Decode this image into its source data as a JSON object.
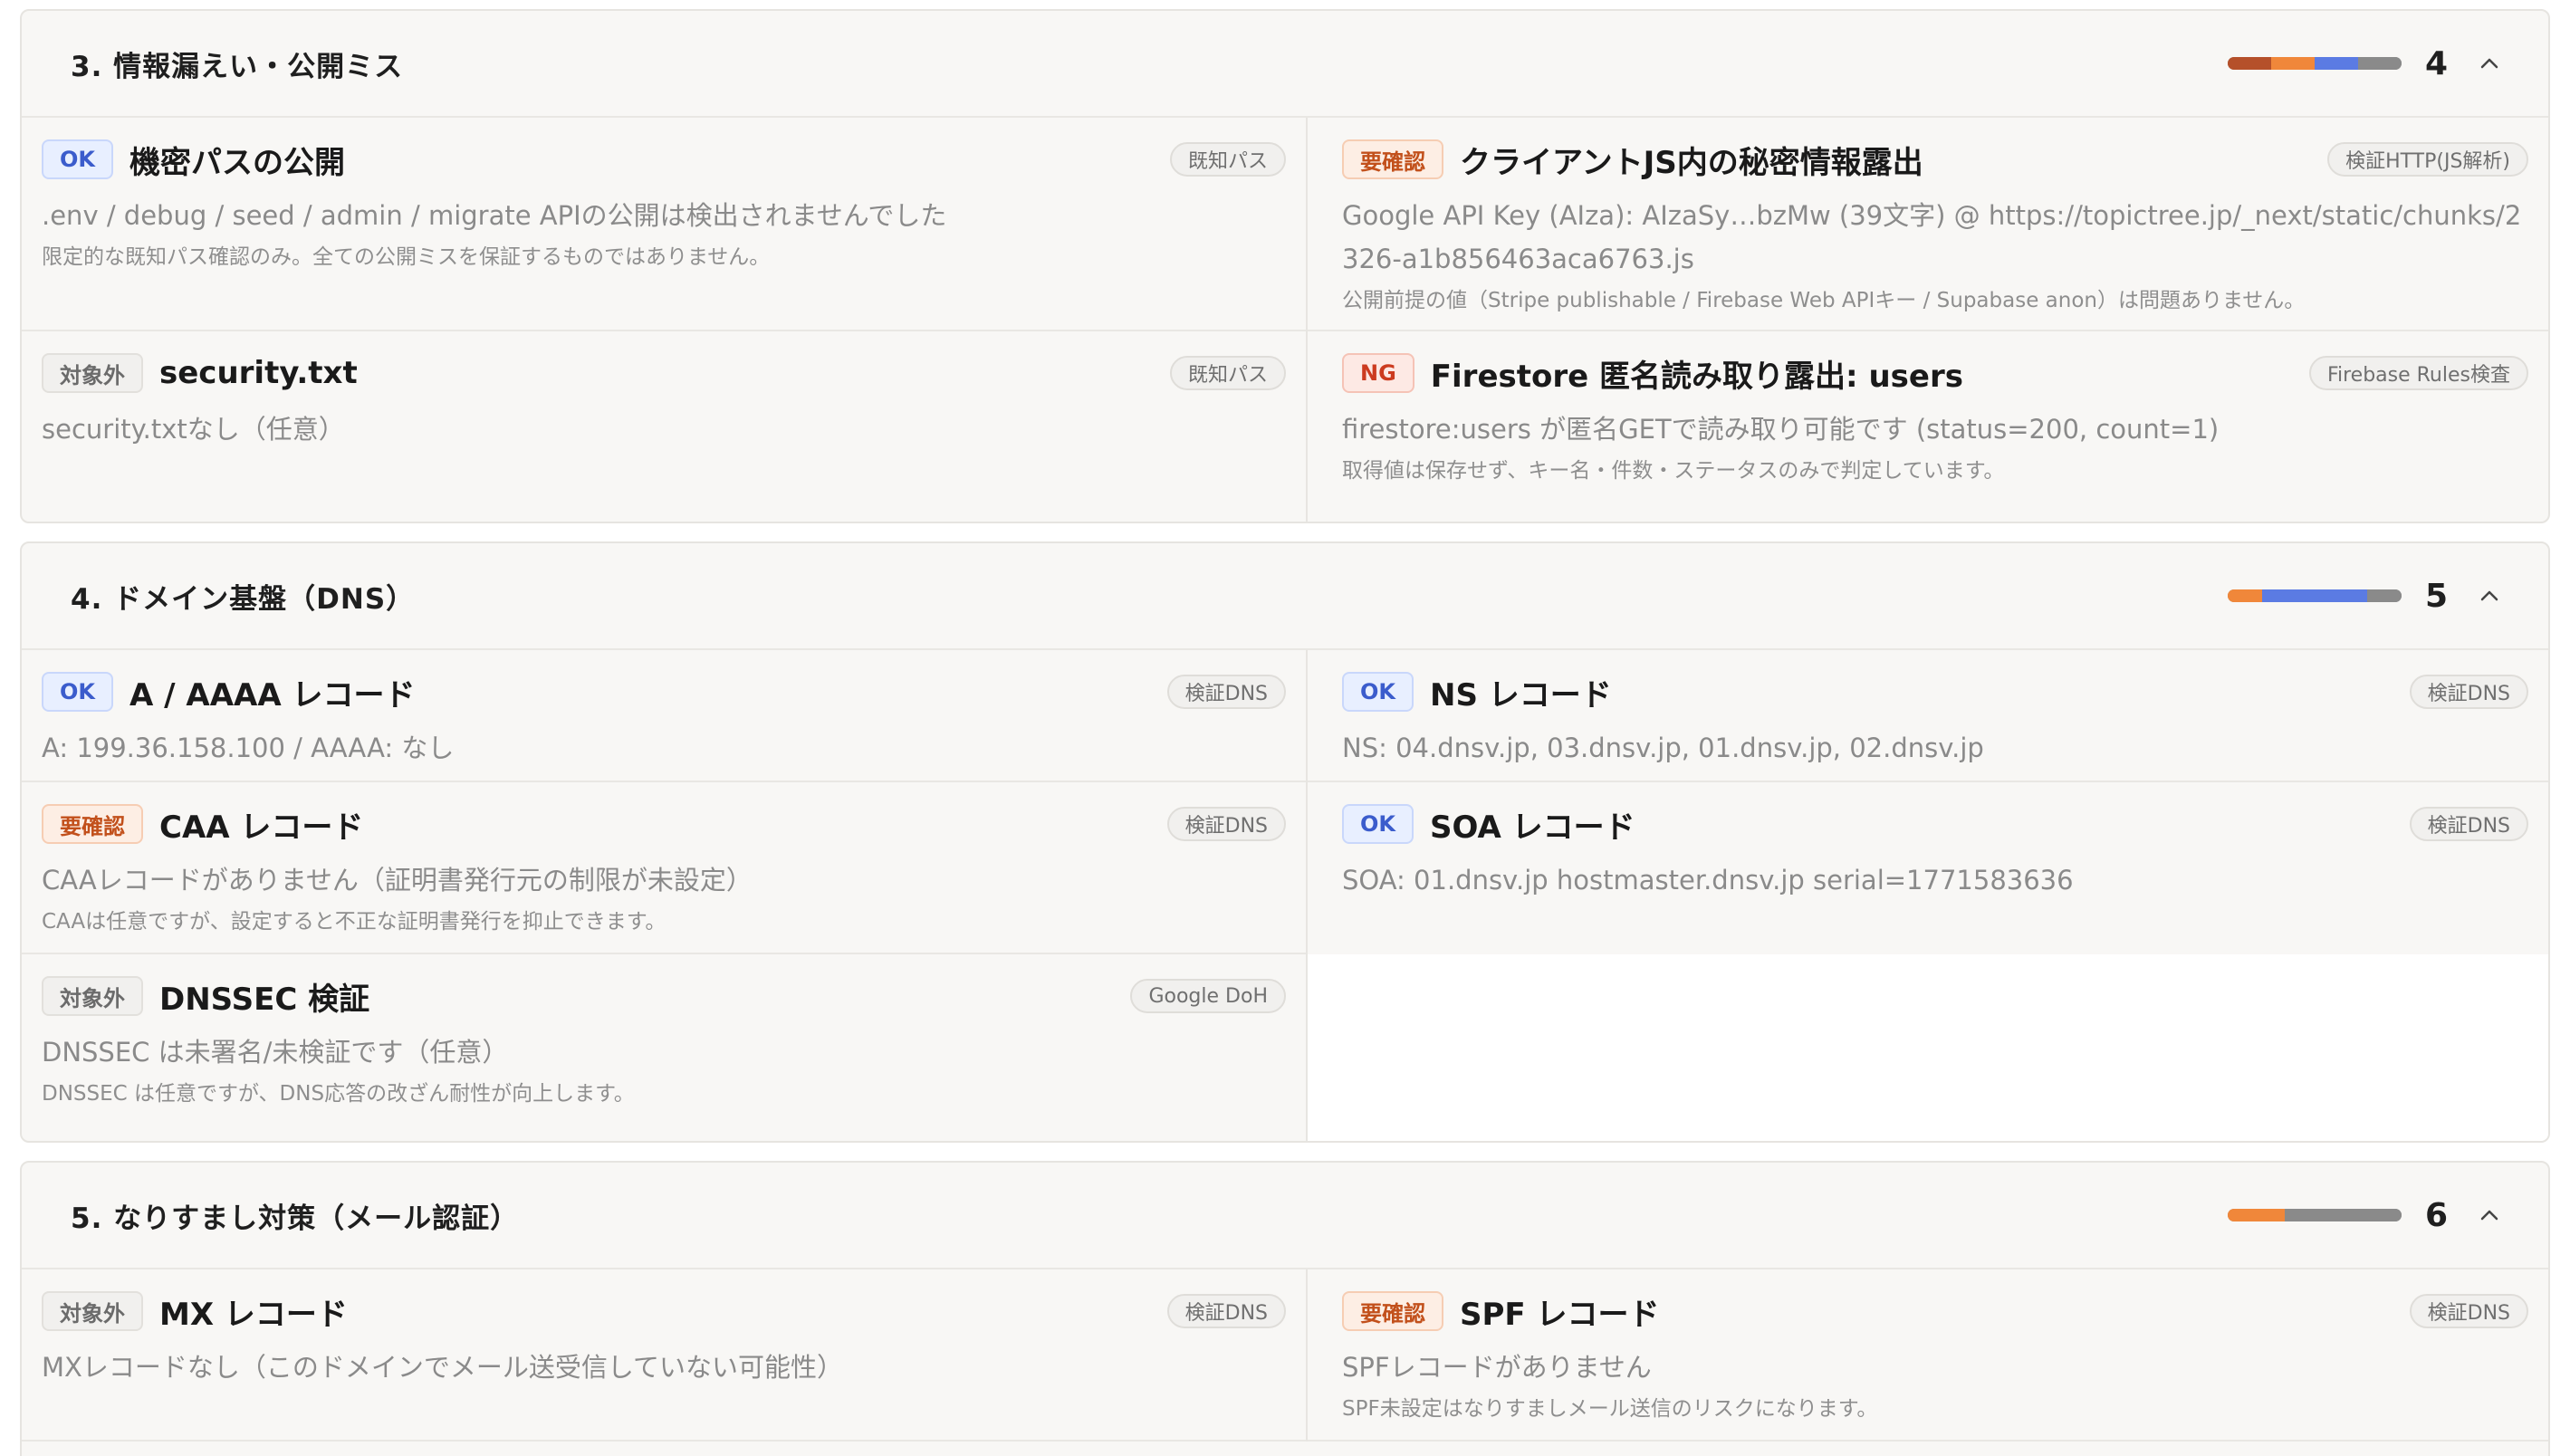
{
  "colors": {
    "ok": "#3b5ccc",
    "warn": "#c2501b",
    "ng": "#cc3b1f",
    "neutral": "#6b6b6b",
    "bar_red": "#b5502a",
    "bar_orange": "#f0873a",
    "bar_blue": "#5b7be3",
    "bar_gray": "#8a8a8a"
  },
  "sections": [
    {
      "title": "3. 情報漏えい・公開ミス",
      "count": "4",
      "chevron_icon": "chevron-up-icon",
      "bar": {
        "red": 0.25,
        "orange": 0.25,
        "blue": 0.25,
        "gray": 0.25
      },
      "items": [
        {
          "status": "OK",
          "title": "機密パスの公開",
          "tag": "既知パス",
          "detail": ".env / debug / seed / admin / migrate APIの公開は検出されませんでした",
          "note": "限定的な既知パス確認のみ。全ての公開ミスを保証するものではありません。"
        },
        {
          "status": "要確認",
          "title": "クライアントJS内の秘密情報露出",
          "tag": "検証HTTP(JS解析)",
          "detail": "Google API Key (AIza): AIzaSy…bzMw (39文字) @ https://topictree.jp/_next/static/chunks/2326-a1b856463aca6763.js",
          "note": "公開前提の値（Stripe publishable / Firebase Web APIキー / Supabase anon）は問題ありません。"
        },
        {
          "status": "対象外",
          "title": "security.txt",
          "tag": "既知パス",
          "detail": "security.txtなし（任意）",
          "note": ""
        },
        {
          "status": "NG",
          "title": "Firestore 匿名読み取り露出: users",
          "tag": "Firebase Rules検査",
          "detail": "firestore:users が匿名GETで読み取り可能です (status=200, count=1)",
          "note": "取得値は保存せず、キー名・件数・ステータスのみで判定しています。"
        }
      ]
    },
    {
      "title": "4. ドメイン基盤（DNS）",
      "count": "5",
      "chevron_icon": "chevron-up-icon",
      "bar": {
        "red": 0,
        "orange": 0.2,
        "blue": 0.6,
        "gray": 0.2
      },
      "items": [
        {
          "status": "OK",
          "title": "A / AAAA レコード",
          "tag": "検証DNS",
          "detail": "A: 199.36.158.100 / AAAA: なし",
          "note": ""
        },
        {
          "status": "OK",
          "title": "NS レコード",
          "tag": "検証DNS",
          "detail": "NS: 04.dnsv.jp, 03.dnsv.jp, 01.dnsv.jp, 02.dnsv.jp",
          "note": ""
        },
        {
          "status": "要確認",
          "title": "CAA レコード",
          "tag": "検証DNS",
          "detail": "CAAレコードがありません（証明書発行元の制限が未設定）",
          "note": "CAAは任意ですが、設定すると不正な証明書発行を抑止できます。"
        },
        {
          "status": "OK",
          "title": "SOA レコード",
          "tag": "検証DNS",
          "detail": "SOA: 01.dnsv.jp hostmaster.dnsv.jp serial=1771583636",
          "note": ""
        },
        {
          "status": "対象外",
          "title": "DNSSEC 検証",
          "tag": "Google DoH",
          "detail": "DNSSEC は未署名/未検証です（任意）",
          "note": "DNSSEC は任意ですが、DNS応答の改ざん耐性が向上します。"
        }
      ]
    },
    {
      "title": "5. なりすまし対策（メール認証）",
      "count": "6",
      "chevron_icon": "chevron-up-icon",
      "bar": {
        "red": 0,
        "orange": 0.33,
        "blue": 0,
        "gray": 0.67
      },
      "items": [
        {
          "status": "対象外",
          "title": "MX レコード",
          "tag": "検証DNS",
          "detail": "MXレコードなし（このドメインでメール送受信していない可能性）",
          "note": ""
        },
        {
          "status": "要確認",
          "title": "SPF レコード",
          "tag": "検証DNS",
          "detail": "SPFレコードがありません",
          "note": "SPF未設定はなりすましメール送信のリスクになります。"
        }
      ]
    }
  ]
}
